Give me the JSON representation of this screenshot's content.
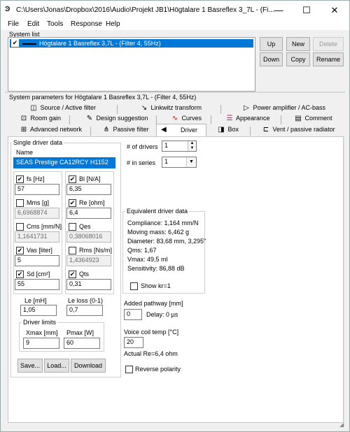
{
  "window": {
    "title": "C:\\Users\\Jonas\\Dropbox\\2016\\Audio\\Projekt JB1\\Högtalare 1 Basreflex 3_7L - (Fi...",
    "icon_name": "app-icon",
    "minimize": "—",
    "maximize": "☐",
    "close": "✕"
  },
  "menu": [
    "File",
    "Edit",
    "Tools",
    "Response",
    "Help"
  ],
  "system_list": {
    "label": "System list",
    "item": "Högtalare 1 Basreflex 3,7L - (Filter 4, 55Hz)",
    "checked": true,
    "buttons": {
      "up": "Up",
      "new": "New",
      "delete": "Delete",
      "down": "Down",
      "copy": "Copy",
      "rename": "Rename"
    }
  },
  "system_params": {
    "label": "System parameters for Högtalare 1 Basreflex 3,7L - (Filter 4, 55Hz)",
    "tabs_row1": [
      "Source / Active filter",
      "Linkwitz transform",
      "Power amplifier / AC-bass"
    ],
    "tabs_row2": [
      "Room gain",
      "Design suggestion",
      "Curves",
      "Appearance",
      "Comment"
    ],
    "tabs_row3": [
      "Advanced network",
      "Passive filter",
      "Driver",
      "Box",
      "Vent / passive radiator"
    ],
    "active_tab": "Driver"
  },
  "driver": {
    "single_driver_label": "Single driver data",
    "name_label": "Name",
    "name_value": "SEAS Prestige CA12RCY H1152",
    "params": {
      "fs": {
        "label": "fs [Hz]",
        "value": "57",
        "checked": true
      },
      "bl": {
        "label": "Bl [N/A]",
        "value": "6,35",
        "checked": true
      },
      "mms": {
        "label": "Mms [g]",
        "value": "6,6968874",
        "checked": false
      },
      "re": {
        "label": "Re [ohm]",
        "value": "6,4",
        "checked": true
      },
      "cms": {
        "label": "Cms [mm/N]",
        "value": "1,1641731",
        "checked": false
      },
      "qes": {
        "label": "Qes",
        "value": "0,38068016",
        "checked": false
      },
      "vas": {
        "label": "Vas [liter]",
        "value": "5",
        "checked": true
      },
      "rms": {
        "label": "Rms [Ns/m]",
        "value": "1,4364923",
        "checked": false
      },
      "sd": {
        "label": "Sd [cm²]",
        "value": "55",
        "checked": true
      },
      "qts": {
        "label": "Qts",
        "value": "0,31",
        "checked": true
      }
    },
    "le_label": "Le [mH]",
    "le_value": "1,05",
    "le_loss_label": "Le loss (0-1)",
    "le_loss_value": "0,7",
    "limits_label": "Driver limits",
    "xmax_label": "Xmax [mm]",
    "xmax_value": "9",
    "pmax_label": "Pmax [W]",
    "pmax_value": "60",
    "save_btn": "Save...",
    "load_btn": "Load...",
    "download_btn": "Download",
    "num_drivers_label": "# of drivers",
    "num_drivers_value": "1",
    "in_series_label": "# in series",
    "in_series_value": "1",
    "equiv_label": "Equivalent driver data",
    "compliance": "Compliance: 1,164 mm/N",
    "moving_mass": "Moving mass: 6,462 g",
    "diameter": "Diameter: 83,68 mm, 3,295\"",
    "qms": "Qms: 1,67",
    "vmax": "Vmax: 49,5 ml",
    "sensitivity": "Sensitivity: 86,88 dB",
    "show_kr": "Show kr=1",
    "added_pathway_label": "Added pathway [mm]",
    "added_pathway_value": "0",
    "delay": "Delay: 0 µs",
    "voice_coil_label": "Voice coil temp [°C]",
    "voice_coil_value": "20",
    "actual_re": "Actual Re=6,4 ohm",
    "reverse_polarity": "Reverse polarity"
  }
}
